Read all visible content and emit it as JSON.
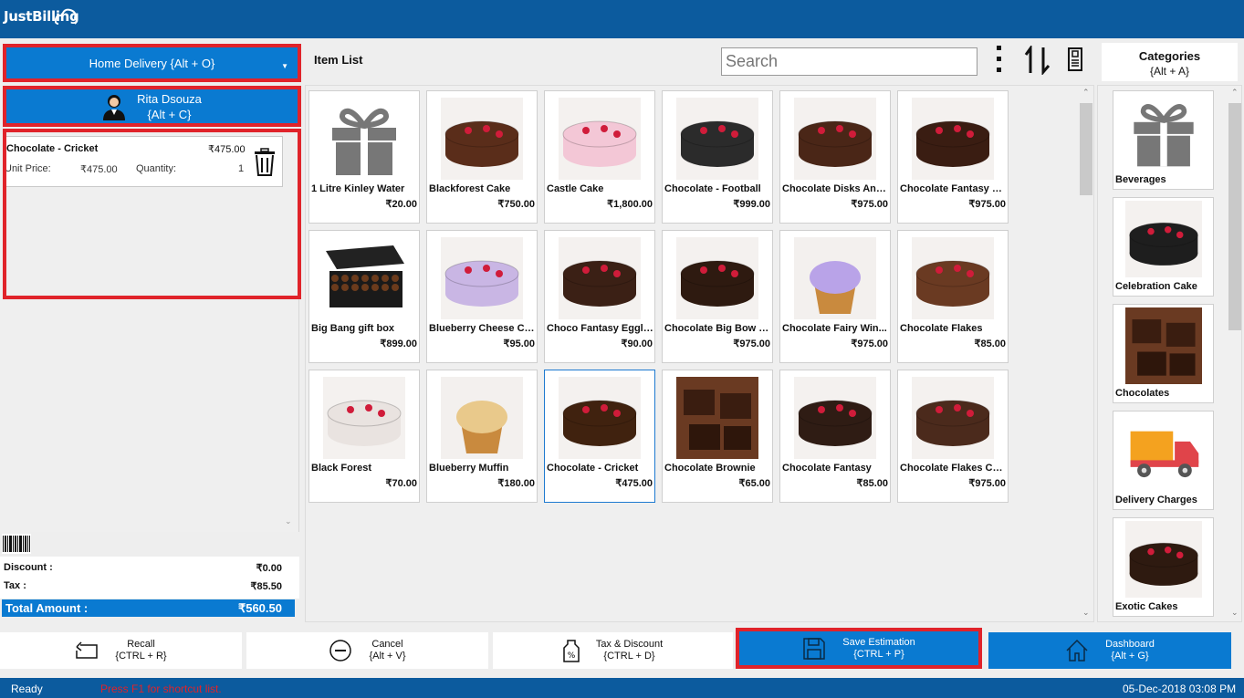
{
  "app": {
    "title": "JustBilling"
  },
  "order": {
    "type_label": "Home Delivery {Alt + O}"
  },
  "customer": {
    "name": "Rita Dsouza",
    "shortcut": "{Alt + C}"
  },
  "cart": {
    "items": [
      {
        "name": "Chocolate - Cricket",
        "total": "₹475.00",
        "unit_price_label": "Unit Price:",
        "unit_price": "₹475.00",
        "quantity_label": "Quantity:",
        "quantity": "1"
      }
    ]
  },
  "summary": {
    "discount_label": "Discount :",
    "discount": "₹0.00",
    "tax_label": "Tax :",
    "tax": "₹85.50",
    "total_label": "Total Amount :",
    "total": "₹560.50"
  },
  "item_list": {
    "title": "Item List",
    "search_placeholder": "Search",
    "items": [
      {
        "name": "1 Litre Kinley Water",
        "price": "₹20.00",
        "icon": "gift-icon"
      },
      {
        "name": "Blackforest Cake",
        "price": "₹750.00",
        "icon": "cake-photo"
      },
      {
        "name": "Castle Cake",
        "price": "₹1,800.00",
        "icon": "cake-photo"
      },
      {
        "name": "Chocolate - Football",
        "price": "₹999.00",
        "icon": "cake-photo"
      },
      {
        "name": "Chocolate Disks And...",
        "price": "₹975.00",
        "icon": "cake-photo"
      },
      {
        "name": "Chocolate Fantasy C...",
        "price": "₹975.00",
        "icon": "cake-photo"
      },
      {
        "name": "Big Bang gift box",
        "price": "₹899.00",
        "icon": "box-photo"
      },
      {
        "name": "Blueberry Cheese Ca...",
        "price": "₹95.00",
        "icon": "cake-photo"
      },
      {
        "name": "Choco Fantasy Eggle...",
        "price": "₹90.00",
        "icon": "cake-photo"
      },
      {
        "name": "Chocolate Big Bow C...",
        "price": "₹975.00",
        "icon": "cake-photo"
      },
      {
        "name": "Chocolate Fairy Win...",
        "price": "₹975.00",
        "icon": "cupcake-photo"
      },
      {
        "name": "Chocolate Flakes",
        "price": "₹85.00",
        "icon": "cake-photo"
      },
      {
        "name": "Black Forest",
        "price": "₹70.00",
        "icon": "cake-photo"
      },
      {
        "name": "Blueberry Muffin",
        "price": "₹180.00",
        "icon": "muffin-photo"
      },
      {
        "name": "Chocolate - Cricket",
        "price": "₹475.00",
        "icon": "cake-photo",
        "selected": true
      },
      {
        "name": "Chocolate Brownie",
        "price": "₹65.00",
        "icon": "brownie-photo"
      },
      {
        "name": "Chocolate Fantasy",
        "price": "₹85.00",
        "icon": "cake-photo"
      },
      {
        "name": "Chocolate Flakes Cake",
        "price": "₹975.00",
        "icon": "cake-photo"
      }
    ]
  },
  "categories": {
    "title": "Categories",
    "shortcut": "{Alt + A}",
    "items": [
      {
        "name": "Beverages",
        "icon": "gift-icon"
      },
      {
        "name": "Celebration Cake",
        "icon": "cake-photo"
      },
      {
        "name": "Chocolates",
        "icon": "chocolate-photo"
      },
      {
        "name": "Delivery Charges",
        "icon": "truck-icon"
      },
      {
        "name": "Exotic Cakes",
        "icon": "cake-photo"
      }
    ]
  },
  "actions": [
    {
      "label": "Recall",
      "shortcut": "{CTRL + R}",
      "icon": "recall-icon"
    },
    {
      "label": "Cancel",
      "shortcut": "{Alt + V}",
      "icon": "cancel-icon"
    },
    {
      "label": "Tax & Discount",
      "shortcut": "{CTRL + D}",
      "icon": "tax-tag-icon"
    },
    {
      "label": "Save Estimation",
      "shortcut": "{CTRL + P}",
      "icon": "save-icon"
    },
    {
      "label": "Dashboard",
      "shortcut": "{Alt + G}",
      "icon": "home-icon"
    }
  ],
  "status": {
    "ready": "Ready",
    "hint": "Press F1 for shortcut list.",
    "datetime": "05-Dec-2018 03:08 PM"
  },
  "colors": {
    "primary": "#0c5b9e",
    "accent": "#0a7ad1",
    "highlight": "#e0232a"
  }
}
